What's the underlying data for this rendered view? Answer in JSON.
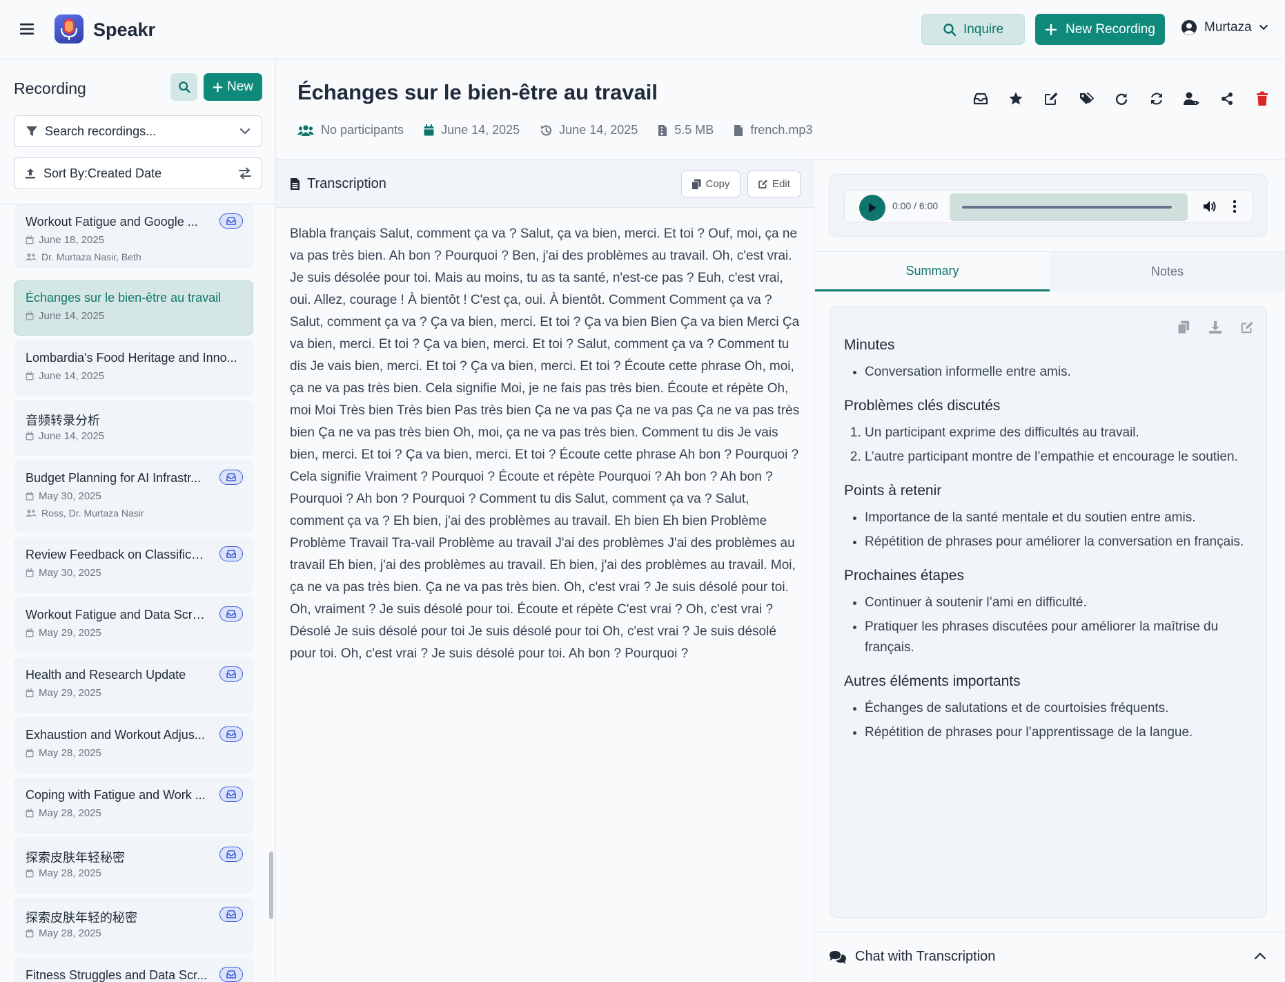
{
  "header": {
    "brand": "Speakr",
    "inquire_label": "Inquire",
    "new_recording_label": "New Recording",
    "user_name": "Murtaza"
  },
  "sidebar": {
    "title": "Recording",
    "new_label": "New",
    "search_placeholder": "Search recordings...",
    "sort_label": "Sort By:Created Date",
    "items": [
      {
        "title": "Workout Fatigue and Google ...",
        "date": "June 18, 2025",
        "participants": "Dr. Murtaza Nasir, Beth",
        "badge": true
      },
      {
        "title": "Échanges sur le bien-être au travail",
        "date": "June 14, 2025",
        "participants": "",
        "badge": false,
        "active": true
      },
      {
        "title": "Lombardia's Food Heritage and Inno...",
        "date": "June 14, 2025",
        "participants": "",
        "badge": false
      },
      {
        "title": "音频转录分析",
        "date": "June 14, 2025",
        "participants": "",
        "badge": false
      },
      {
        "title": "Budget Planning for AI Infrastr...",
        "date": "May 30, 2025",
        "participants": "Ross, Dr. Murtaza Nasir",
        "badge": true
      },
      {
        "title": "Review Feedback on Classificat...",
        "date": "May 30, 2025",
        "participants": "",
        "badge": true
      },
      {
        "title": "Workout Fatigue and Data Scra...",
        "date": "May 29, 2025",
        "participants": "",
        "badge": true
      },
      {
        "title": "Health and Research Update",
        "date": "May 29, 2025",
        "participants": "",
        "badge": true
      },
      {
        "title": "Exhaustion and Workout Adjus...",
        "date": "May 28, 2025",
        "participants": "",
        "badge": true
      },
      {
        "title": "Coping with Fatigue and Work ...",
        "date": "May 28, 2025",
        "participants": "",
        "badge": true
      },
      {
        "title": "探索皮肤年轻秘密",
        "date": "May 28, 2025",
        "participants": "",
        "badge": true
      },
      {
        "title": "探索皮肤年轻的秘密",
        "date": "May 28, 2025",
        "participants": "",
        "badge": true
      },
      {
        "title": "Fitness Struggles and Data Scr...",
        "date": "",
        "participants": "",
        "badge": true
      }
    ]
  },
  "recording": {
    "title": "Échanges sur le bien-être au travail",
    "participants": "No participants",
    "created_date": "June 14, 2025",
    "meeting_date": "June 14, 2025",
    "size": "5.5 MB",
    "filename": "french.mp3"
  },
  "transcription": {
    "title": "Transcription",
    "copy_label": "Copy",
    "edit_label": "Edit",
    "text": "Blabla français Salut, comment ça va ? Salut, ça va bien, merci. Et toi ? Ouf, moi, ça ne va pas très bien. Ah bon ? Pourquoi ? Ben, j'ai des problèmes au travail. Oh, c'est vrai. Je suis désolée pour toi. Mais au moins, tu as ta santé, n'est-ce pas ? Euh, c'est vrai, oui. Allez, courage ! À bientôt ! C'est ça, oui. À bientôt. Comment Comment ça va ? Salut, comment ça va ? Ça va bien, merci. Et toi ? Ça va bien Bien Ça va bien Merci Ça va bien, merci. Et toi ? Ça va bien, merci. Et toi ? Salut, comment ça va ? Comment tu dis Je vais bien, merci. Et toi ? Ça va bien, merci. Et toi ? Écoute cette phrase Oh, moi, ça ne va pas très bien. Cela signifie Moi, je ne fais pas très bien. Écoute et répète Oh, moi Moi Très bien Très bien Pas très bien Ça ne va pas Ça ne va pas Ça ne va pas très bien Ça ne va pas très bien Oh, moi, ça ne va pas très bien. Comment tu dis Je vais bien, merci. Et toi ? Ça va bien, merci. Et toi ? Écoute cette phrase Ah bon ? Pourquoi ? Cela signifie Vraiment ? Pourquoi ? Écoute et répète Pourquoi ? Ah bon ? Ah bon ? Pourquoi ? Ah bon ? Pourquoi ? Comment tu dis Salut, comment ça va ? Salut, comment ça va ? Eh bien, j'ai des problèmes au travail. Eh bien Eh bien Problème Problème Travail Tra-vail Problème au travail J'ai des problèmes J'ai des problèmes au travail Eh bien, j'ai des problèmes au travail. Eh bien, j'ai des problèmes au travail. Moi, ça ne va pas très bien. Ça ne va pas très bien. Oh, c'est vrai ? Je suis désolé pour toi. Oh, vraiment ? Je suis désolé pour toi. Écoute et répète C'est vrai ? Oh, c'est vrai ? Désolé Je suis désolé pour toi Je suis désolé pour toi Oh, c'est vrai ? Je suis désolé pour toi. Oh, c'est vrai ? Je suis désolé pour toi. Ah bon ? Pourquoi ?"
  },
  "player": {
    "time": "0:00 / 6:00",
    "progress": 0
  },
  "tabs": {
    "summary": "Summary",
    "notes": "Notes"
  },
  "summary": {
    "sections": [
      {
        "heading": "Minutes",
        "ordered": false,
        "items": [
          "Conversation informelle entre amis."
        ]
      },
      {
        "heading": "Problèmes clés discutés",
        "ordered": true,
        "items": [
          "Un participant exprime des difficultés au travail.",
          "L’autre participant montre de l’empathie et encourage le soutien."
        ]
      },
      {
        "heading": "Points à retenir",
        "ordered": false,
        "items": [
          "Importance de la santé mentale et du soutien entre amis.",
          "Répétition de phrases pour améliorer la conversation en français."
        ]
      },
      {
        "heading": "Prochaines étapes",
        "ordered": false,
        "items": [
          "Continuer à soutenir l’ami en difficulté.",
          "Pratiquer les phrases discutées pour améliorer la maîtrise du français."
        ]
      },
      {
        "heading": "Autres éléments importants",
        "ordered": false,
        "items": [
          "Échanges de salutations et de courtoisies fréquents.",
          "Répétition de phrases pour l’apprentissage de la langue."
        ]
      }
    ]
  },
  "chat": {
    "label": "Chat with Transcription"
  },
  "colors": {
    "accent": "#0f766e",
    "accent_button": "#0f8a7a",
    "delete": "#dc2626",
    "badge": "#3b5bdb"
  }
}
